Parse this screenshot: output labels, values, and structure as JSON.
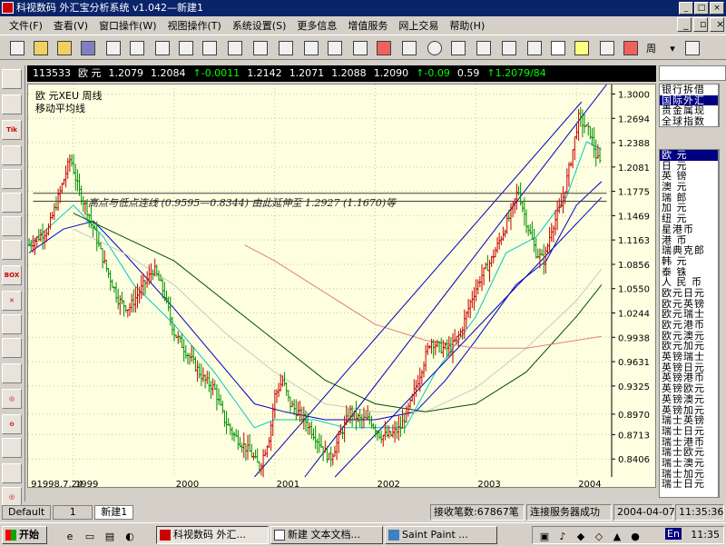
{
  "window": {
    "title": "科视数码 外汇宝分析系统 v1.042—新建1"
  },
  "menu": [
    "文件(F)",
    "查看(V)",
    "窗口操作(W)",
    "视图操作(T)",
    "系统设置(S)",
    "更多信息",
    "增值服务",
    "网上交易",
    "帮助(H)"
  ],
  "toolbar": {
    "period": "周"
  },
  "leftbar": [
    {
      "name": "draw-line-icon"
    },
    {
      "name": "draw-ray-icon"
    },
    {
      "name": "tik-icon",
      "text": "Tik"
    },
    {
      "name": "trend-icon"
    },
    {
      "name": "channel-icon"
    },
    {
      "name": "fibonacci-icon"
    },
    {
      "name": "gann-icon"
    },
    {
      "name": "arc-icon"
    },
    {
      "name": "box-icon",
      "text": "BOX"
    },
    {
      "name": "delete-icon"
    },
    {
      "name": "eraser-icon"
    },
    {
      "name": "chart-icon"
    },
    {
      "name": "chart2-icon"
    },
    {
      "name": "target-icon"
    },
    {
      "name": "minus-icon"
    },
    {
      "name": "trend2-icon"
    },
    {
      "name": "bar-icon"
    },
    {
      "name": "target2-icon"
    }
  ],
  "quote": {
    "code": "113533",
    "name": "欧  元",
    "open": "1.2079",
    "high": "1.2084",
    "chg1": "-0.0011",
    "v1": "1.2142",
    "v2": "1.2071",
    "v3": "1.2088",
    "v4": "1.2090",
    "chg2": "-0.09",
    "pct": "0.59",
    "last": "1.2079/84"
  },
  "chart_data": {
    "type": "candlestick",
    "title": "欧    元XEU    周线",
    "subtitle": "移动平均线",
    "annotation": "高点与低点连线 (0.9595—0.8344) 由此延伸至 1.2927 (1.1670)等",
    "yticks": [
      1.3,
      1.2694,
      1.2388,
      1.2081,
      1.1775,
      1.1469,
      1.1163,
      1.0856,
      1.055,
      1.0244,
      0.9938,
      0.9631,
      0.9325,
      0.897,
      0.8713,
      0.8406
    ],
    "ytick_labels": [
      "1.3000",
      "1.2694",
      "1.2388",
      "1.2081",
      "1.1775",
      "1.1469",
      "1.1163",
      "1.0856",
      "1.0550",
      "1.0244",
      "0.9938",
      "0.9631",
      "0.9325",
      "0.8970",
      "0.8713",
      "0.8406"
    ],
    "ylim": [
      0.818,
      1.312
    ],
    "xlim": [
      1998.55,
      2004.35
    ],
    "xticks": [
      {
        "label": "91998.7.24",
        "x": 1998.56
      },
      {
        "label": "1999",
        "x": 1999.0
      },
      {
        "label": "2000",
        "x": 2000.0
      },
      {
        "label": "2001",
        "x": 2001.0
      },
      {
        "label": "2002",
        "x": 2002.0
      },
      {
        "label": "2003",
        "x": 2003.0
      },
      {
        "label": "2004",
        "x": 2004.0
      }
    ],
    "price_path": [
      [
        1998.56,
        1.11
      ],
      [
        1998.75,
        1.13
      ],
      [
        1998.9,
        1.19
      ],
      [
        1998.97,
        1.22
      ],
      [
        1999.05,
        1.18
      ],
      [
        1999.15,
        1.15
      ],
      [
        1999.3,
        1.09
      ],
      [
        1999.45,
        1.04
      ],
      [
        1999.55,
        1.03
      ],
      [
        1999.7,
        1.06
      ],
      [
        1999.8,
        1.08
      ],
      [
        1999.9,
        1.05
      ],
      [
        2000.0,
        1.0
      ],
      [
        2000.15,
        0.97
      ],
      [
        2000.3,
        0.94
      ],
      [
        2000.4,
        0.93
      ],
      [
        2000.5,
        0.89
      ],
      [
        2000.6,
        0.87
      ],
      [
        2000.75,
        0.85
      ],
      [
        2000.85,
        0.83
      ],
      [
        2000.95,
        0.87
      ],
      [
        2001.0,
        0.92
      ],
      [
        2001.08,
        0.94
      ],
      [
        2001.15,
        0.91
      ],
      [
        2001.3,
        0.89
      ],
      [
        2001.45,
        0.86
      ],
      [
        2001.55,
        0.84
      ],
      [
        2001.65,
        0.87
      ],
      [
        2001.75,
        0.9
      ],
      [
        2001.85,
        0.89
      ],
      [
        2001.95,
        0.89
      ],
      [
        2002.05,
        0.87
      ],
      [
        2002.15,
        0.87
      ],
      [
        2002.25,
        0.88
      ],
      [
        2002.35,
        0.91
      ],
      [
        2002.45,
        0.95
      ],
      [
        2002.55,
        0.99
      ],
      [
        2002.65,
        0.98
      ],
      [
        2002.75,
        0.98
      ],
      [
        2002.85,
        1.0
      ],
      [
        2002.95,
        1.04
      ],
      [
        2003.05,
        1.07
      ],
      [
        2003.15,
        1.09
      ],
      [
        2003.25,
        1.12
      ],
      [
        2003.35,
        1.15
      ],
      [
        2003.42,
        1.18
      ],
      [
        2003.5,
        1.14
      ],
      [
        2003.6,
        1.1
      ],
      [
        2003.68,
        1.09
      ],
      [
        2003.75,
        1.13
      ],
      [
        2003.85,
        1.16
      ],
      [
        2003.95,
        1.22
      ],
      [
        2004.02,
        1.27
      ],
      [
        2004.08,
        1.26
      ],
      [
        2004.14,
        1.25
      ],
      [
        2004.2,
        1.22
      ],
      [
        2004.25,
        1.21
      ]
    ],
    "ma_series": [
      {
        "color": "#00c8c8",
        "points": [
          [
            1998.56,
            1.11
          ],
          [
            1999.0,
            1.16
          ],
          [
            1999.3,
            1.12
          ],
          [
            1999.6,
            1.06
          ],
          [
            2000.0,
            1.01
          ],
          [
            2000.4,
            0.95
          ],
          [
            2000.8,
            0.88
          ],
          [
            2001.0,
            0.89
          ],
          [
            2001.4,
            0.89
          ],
          [
            2001.7,
            0.88
          ],
          [
            2002.0,
            0.88
          ],
          [
            2002.3,
            0.88
          ],
          [
            2002.6,
            0.95
          ],
          [
            2003.0,
            1.02
          ],
          [
            2003.3,
            1.1
          ],
          [
            2003.6,
            1.12
          ],
          [
            2003.9,
            1.17
          ],
          [
            2004.1,
            1.24
          ],
          [
            2004.25,
            1.23
          ]
        ]
      },
      {
        "color": "#0000c8",
        "points": [
          [
            1998.56,
            1.1
          ],
          [
            1998.9,
            1.13
          ],
          [
            1999.2,
            1.14
          ],
          [
            1999.5,
            1.1
          ],
          [
            2000.0,
            1.03
          ],
          [
            2000.4,
            0.97
          ],
          [
            2000.8,
            0.91
          ],
          [
            2001.1,
            0.9
          ],
          [
            2001.5,
            0.89
          ],
          [
            2002.0,
            0.89
          ],
          [
            2002.4,
            0.9
          ],
          [
            2002.7,
            0.94
          ],
          [
            2003.0,
            0.99
          ],
          [
            2003.4,
            1.06
          ],
          [
            2003.7,
            1.09
          ],
          [
            2004.0,
            1.16
          ],
          [
            2004.25,
            1.19
          ]
        ]
      },
      {
        "color": "#c8c8c8",
        "points": [
          [
            1999.0,
            1.13
          ],
          [
            1999.5,
            1.1
          ],
          [
            2000.0,
            1.06
          ],
          [
            2000.5,
            1.0
          ],
          [
            2001.0,
            0.95
          ],
          [
            2001.5,
            0.91
          ],
          [
            2002.0,
            0.9
          ],
          [
            2002.5,
            0.9
          ],
          [
            2003.0,
            0.93
          ],
          [
            2003.5,
            0.98
          ],
          [
            2004.0,
            1.04
          ],
          [
            2004.25,
            1.08
          ]
        ]
      },
      {
        "color": "#005000",
        "points": [
          [
            1999.0,
            1.15
          ],
          [
            1999.5,
            1.12
          ],
          [
            2000.0,
            1.09
          ],
          [
            2000.5,
            1.04
          ],
          [
            2001.0,
            0.99
          ],
          [
            2001.5,
            0.94
          ],
          [
            2002.0,
            0.91
          ],
          [
            2002.5,
            0.9
          ],
          [
            2003.0,
            0.91
          ],
          [
            2003.5,
            0.95
          ],
          [
            2004.0,
            1.02
          ],
          [
            2004.25,
            1.06
          ]
        ]
      },
      {
        "color": "#e08080",
        "points": [
          [
            2000.7,
            1.11
          ],
          [
            2001.0,
            1.09
          ],
          [
            2001.5,
            1.05
          ],
          [
            2002.0,
            1.01
          ],
          [
            2002.5,
            0.99
          ],
          [
            2003.0,
            0.98
          ],
          [
            2003.5,
            0.98
          ],
          [
            2004.0,
            0.99
          ],
          [
            2004.25,
            0.995
          ]
        ]
      }
    ],
    "trend_lines": [
      {
        "color": "#0000c0",
        "from": [
          2000.8,
          0.818
        ],
        "to": [
          2004.05,
          1.29
        ]
      },
      {
        "color": "#0000c0",
        "from": [
          2001.6,
          0.818
        ],
        "to": [
          2004.25,
          1.17
        ]
      },
      {
        "color": "#0000c0",
        "from": [
          2001.3,
          0.818
        ],
        "to": [
          2004.3,
          1.312
        ]
      },
      {
        "color": "#404040",
        "from": [
          1998.6,
          1.175
        ],
        "to": [
          2004.3,
          1.175
        ]
      },
      {
        "color": "#404040",
        "from": [
          1998.6,
          1.165
        ],
        "to": [
          2004.3,
          1.165
        ]
      }
    ],
    "grid": true
  },
  "rightpanel": {
    "categories": [
      "银行拆借",
      "国际外汇",
      "贵金属现",
      "全球指数"
    ],
    "currencies": [
      "欧    元",
      "日    元",
      "英    镑",
      "澳    元",
      "瑞    郎",
      "加    元",
      "纽    元",
      "星港币",
      "港    币",
      "瑞典克郎",
      "韩    元",
      "泰    铢",
      "人 民 币",
      "欧元日元",
      "欧元英镑",
      "欧元瑞士",
      "欧元港币",
      "欧元澳元",
      "欧元加元",
      "英镑瑞士",
      "英镑日元",
      "英镑港币",
      "英镑欧元",
      "英镑澳元",
      "英镑加元",
      "瑞士英镑",
      "瑞士日元",
      "瑞士港币",
      "瑞士欧元",
      "瑞士澳元",
      "瑞士加元",
      "瑞士日元"
    ]
  },
  "tabs": [
    "Default",
    "1",
    "新建1"
  ],
  "status": {
    "received": "接收笔数:67867笔",
    "server": "连接服务器成功",
    "date": "2004-04-07",
    "time": "11:35:36"
  },
  "taskbar": {
    "start": "开始",
    "tasks": [
      "科视数码 外汇...",
      "新建 文本文档...",
      "Saint Paint ..."
    ],
    "lang": "En",
    "clock": "11:35"
  }
}
